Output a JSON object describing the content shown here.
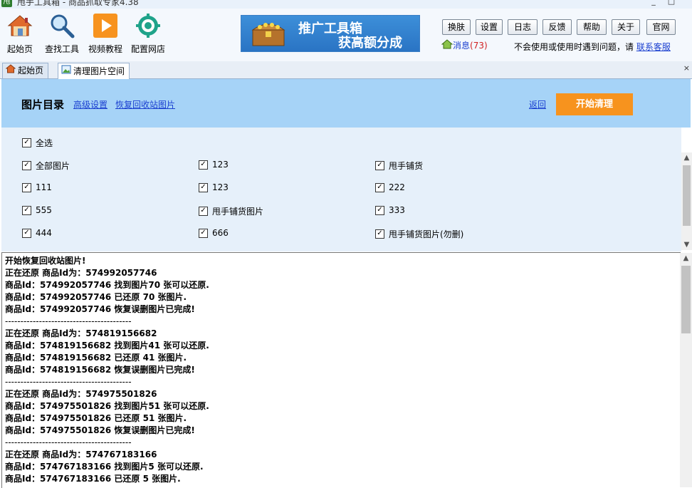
{
  "window": {
    "title": "甩手工具箱 - 商品抓取专家4.38",
    "app_icon_text": "甩",
    "minimize": "_",
    "maximize": "□"
  },
  "toolbar": {
    "items": [
      {
        "label": "起始页",
        "icon": "home-icon"
      },
      {
        "label": "查找工具",
        "icon": "magnifier-icon"
      },
      {
        "label": "视频教程",
        "icon": "video-play-icon"
      },
      {
        "label": "配置网店",
        "icon": "settings-gear-icon"
      }
    ],
    "banner": {
      "line1": "推广工具箱",
      "line2": "获高额分成",
      "icon": "treasure-chest-icon"
    },
    "buttons": [
      "换肤",
      "设置",
      "日志",
      "反馈",
      "帮助",
      "关于",
      "官网"
    ],
    "message_label": "消息",
    "message_count": "(73)",
    "help_text": "不会使用或使用时遇到问题，请",
    "help_link": "联系客服"
  },
  "tabs": [
    {
      "label": "起始页",
      "icon": "home-icon"
    },
    {
      "label": "清理图片空间",
      "icon": "image-icon"
    }
  ],
  "tabs_close": "×",
  "panel": {
    "title": "图片目录",
    "link_advanced": "高级设置",
    "link_restore": "恢复回收站图片",
    "link_back": "返回",
    "start_button": "开始清理"
  },
  "checkboxes": {
    "select_all": "全选",
    "check_mark": "✓",
    "items": [
      {
        "label": "全部图片",
        "checked": true
      },
      {
        "label": "123",
        "checked": true
      },
      {
        "label": "甩手铺货",
        "checked": true
      },
      {
        "label": "111",
        "checked": true
      },
      {
        "label": "123",
        "checked": true
      },
      {
        "label": "222",
        "checked": true
      },
      {
        "label": "555",
        "checked": true
      },
      {
        "label": "甩手铺货图片",
        "checked": true
      },
      {
        "label": "333",
        "checked": true
      },
      {
        "label": "444",
        "checked": true
      },
      {
        "label": "666",
        "checked": true
      },
      {
        "label": "甩手铺货图片(勿删)",
        "checked": true
      }
    ]
  },
  "log": {
    "lines": [
      "开始恢复回收站图片!",
      "正在还原  商品Id为：574992057746",
      "商品Id：574992057746 找到图片70 张可以还原.",
      "商品Id：574992057746 已还原 70 张图片.",
      "商品Id：574992057746 恢复误删图片已完成!",
      "-----------------------------------------",
      "正在还原  商品Id为：574819156682",
      "商品Id：574819156682 找到图片41 张可以还原.",
      "商品Id：574819156682 已还原 41 张图片.",
      "商品Id：574819156682 恢复误删图片已完成!",
      "-----------------------------------------",
      "正在还原  商品Id为：574975501826",
      "商品Id：574975501826 找到图片51 张可以还原.",
      "商品Id：574975501826 已还原 51 张图片.",
      "商品Id：574975501826 恢复误删图片已完成!",
      "-----------------------------------------",
      "正在还原  商品Id为：574767183166",
      "商品Id：574767183166 找到图片5 张可以还原.",
      "商品Id：574767183166 已还原 5 张图片."
    ]
  },
  "scroll_arrows": {
    "up": "▲",
    "down": "▼"
  },
  "colors": {
    "accent_orange": "#f7931e",
    "panel_blue": "#a6d3f7",
    "link_blue": "#1a3fd0",
    "message_count_red": "#d02020"
  }
}
